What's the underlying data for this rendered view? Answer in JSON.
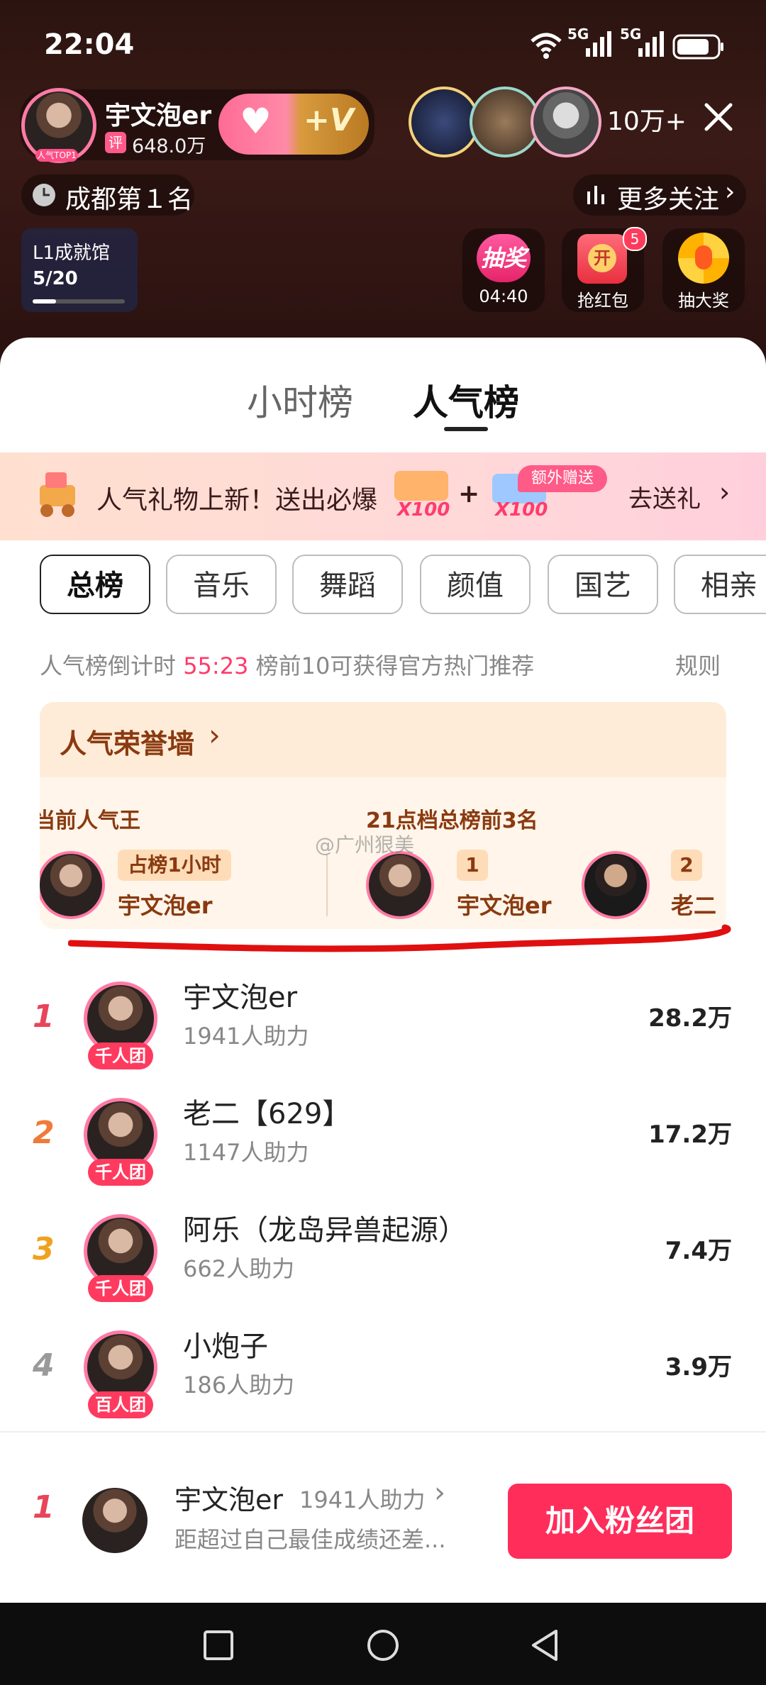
{
  "status_bar": {
    "time": "22:04",
    "net1": "5G",
    "net2": "5G"
  },
  "host": {
    "name": "宇文泡er",
    "rating_tag": "评",
    "rating_value": "648.0万",
    "badge": "人气TOP1"
  },
  "viewers_count": "10万+",
  "rank_city": "成都第１名",
  "more_follow": "更多关注",
  "achievement": {
    "title": "L1成就馆",
    "progress_text": "5/20",
    "progress": 0.25
  },
  "actions": {
    "lottery_label": "抽奖",
    "lottery_timer": "04:40",
    "redpacket_icon_text": "开",
    "redpacket_count": "5",
    "redpacket_label": "抢红包",
    "bigprize_label": "抽大奖"
  },
  "tabs": [
    "小时榜",
    "人气榜"
  ],
  "promo": {
    "text": "人气礼物上新！送出必爆",
    "extra_tag": "额外赠送",
    "mult1": "X100",
    "plus": "+",
    "mult2": "X100",
    "cta": "去送礼"
  },
  "categories": [
    "总榜",
    "音乐",
    "舞蹈",
    "颜值",
    "国艺",
    "相亲"
  ],
  "countdown": {
    "prefix": "人气榜倒计时",
    "time": "55:23",
    "suffix": "榜前10可获得官方热门推荐",
    "rules": "规则"
  },
  "honor": {
    "title": "人气荣誉墙",
    "left_label": "当前人气王",
    "left_tag": "占榜1小时",
    "left_name": "宇文泡er",
    "right_label": "21点档总榜前3名",
    "right1_rank": "1",
    "right1_name": "宇文泡er",
    "right2_rank": "2",
    "right2_name": "老二"
  },
  "watermark": "@广州狠美",
  "ranking": [
    {
      "rank": "1",
      "name": "宇文泡er",
      "support": "1941人助力",
      "score": "28.2万",
      "badge": "千人团",
      "color": "#e8455a"
    },
    {
      "rank": "2",
      "name": "老二【629】",
      "support": "1147人助力",
      "score": "17.2万",
      "badge": "千人团",
      "color": "#f07a3a"
    },
    {
      "rank": "3",
      "name": "阿乐（龙岛异兽起源）",
      "support": "662人助力",
      "score": "7.4万",
      "badge": "千人团",
      "color": "#f0a21e"
    },
    {
      "rank": "4",
      "name": "小炮子",
      "support": "186人助力",
      "score": "3.9万",
      "badge": "百人团",
      "color": "#9a9a9a"
    }
  ],
  "bottom": {
    "rank": "1",
    "name": "宇文泡er",
    "support": "1941人助力",
    "desc": "距超过自己最佳成绩还差...",
    "cta": "加入粉丝团"
  },
  "nav_icons": [
    "square-icon",
    "circle-icon",
    "back-triangle-icon"
  ]
}
